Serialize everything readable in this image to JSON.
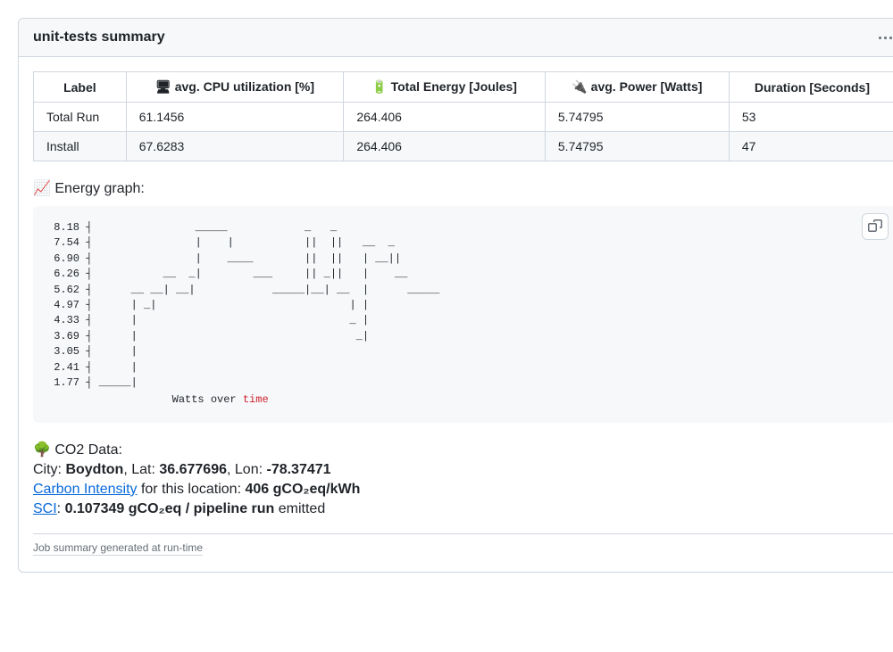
{
  "header": {
    "title": "unit-tests summary"
  },
  "table": {
    "headers": {
      "label": "Label",
      "cpu": "🖥 avg. CPU utilization [%]",
      "energy": "🔋 Total Energy [Joules]",
      "power": "🔌 avg. Power [Watts]",
      "duration": "Duration [Seconds]"
    },
    "rows": [
      {
        "label": "Total Run",
        "cpu": "61.1456",
        "energy": "264.406",
        "power": "5.74795",
        "duration": "53"
      },
      {
        "label": "Install",
        "cpu": "67.6283",
        "energy": "264.406",
        "power": "5.74795",
        "duration": "47"
      }
    ]
  },
  "energy_graph": {
    "label": "📈 Energy graph:",
    "caption_prefix": "Watts over ",
    "caption_time": "time"
  },
  "chart_data": {
    "type": "line",
    "title": "Watts over time",
    "xlabel": "time",
    "ylabel": "Watts",
    "ylim": [
      1.77,
      8.18
    ],
    "y_ticks": [
      8.18,
      7.54,
      6.9,
      6.26,
      5.62,
      4.97,
      4.33,
      3.69,
      3.05,
      2.41,
      1.77
    ],
    "x": [
      0,
      1,
      2,
      3,
      4,
      5,
      6,
      7,
      8,
      9,
      10,
      11,
      12,
      13,
      14,
      15,
      16,
      17,
      18,
      19,
      20,
      21,
      22,
      23,
      24,
      25,
      26,
      27,
      28,
      29,
      30,
      31,
      32,
      33,
      34,
      35,
      36,
      37,
      38,
      39,
      40,
      41,
      42,
      43,
      44,
      45,
      46,
      47,
      48,
      49,
      50,
      51,
      52
    ],
    "values": [
      1.77,
      1.77,
      1.77,
      1.77,
      1.77,
      5.62,
      5.62,
      4.97,
      5.62,
      5.62,
      6.26,
      6.26,
      5.62,
      5.62,
      6.26,
      8.18,
      8.18,
      8.18,
      8.18,
      8.18,
      6.9,
      6.9,
      6.9,
      6.9,
      6.26,
      6.26,
      6.26,
      5.62,
      5.62,
      5.62,
      5.62,
      5.62,
      8.18,
      5.62,
      5.62,
      6.26,
      8.18,
      5.62,
      5.62,
      4.33,
      3.69,
      7.54,
      7.54,
      6.9,
      6.9,
      7.54,
      6.26,
      6.26,
      5.62,
      5.62,
      5.62,
      5.62,
      5.62
    ]
  },
  "co2": {
    "heading": "🌳 CO2 Data:",
    "city_label": "City: ",
    "city": "Boydton",
    "lat_label": ", Lat: ",
    "lat": "36.677696",
    "lon_label": ", Lon: ",
    "lon": "-78.37471",
    "carbon_intensity_link": "Carbon Intensity",
    "carbon_intensity_text": " for this location: ",
    "carbon_intensity_value": "406 gCO₂eq/kWh",
    "sci_link": "SCI",
    "sci_sep": ": ",
    "sci_value": "0.107349 gCO₂eq / pipeline run",
    "sci_suffix": " emitted"
  },
  "footer": {
    "link": "Job summary generated at run-time"
  }
}
